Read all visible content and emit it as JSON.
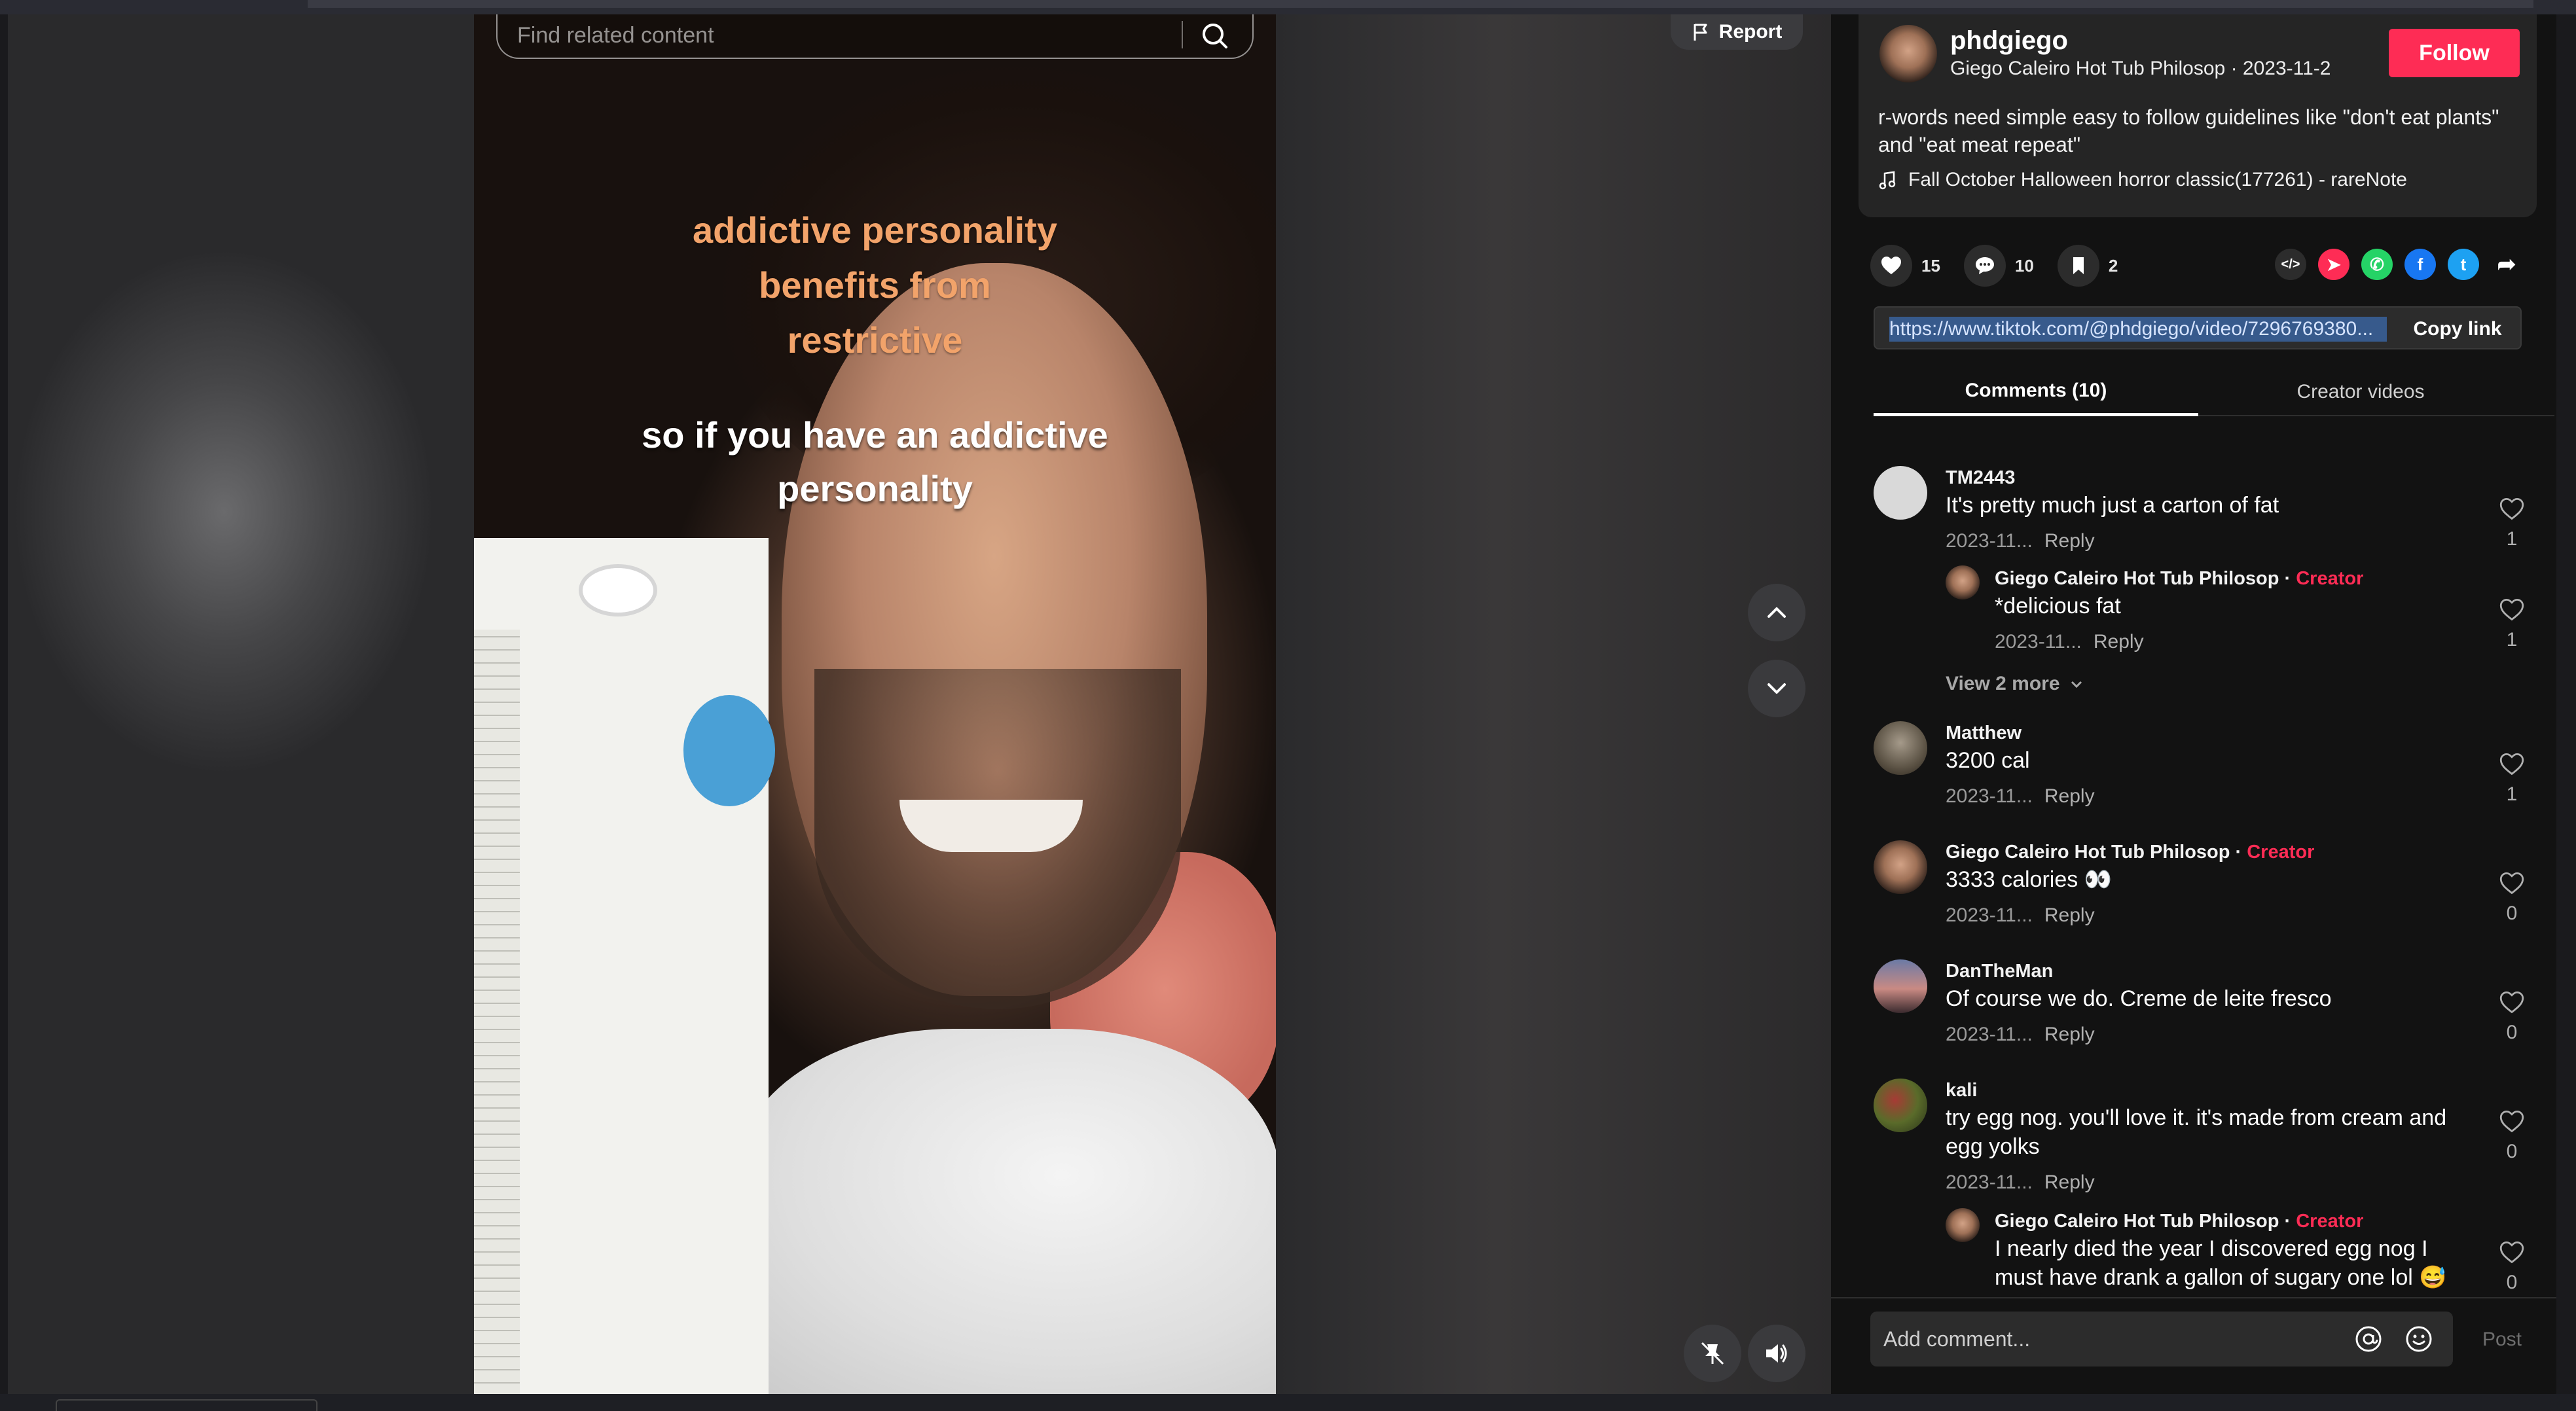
{
  "search": {
    "placeholder": "Find related content"
  },
  "report": {
    "label": "Report"
  },
  "video": {
    "overlay_lines": [
      "addictive personality",
      "benefits from",
      "restrictive"
    ],
    "caption_lines": [
      "so if you have an addictive",
      "personality"
    ]
  },
  "author": {
    "username": "phdgiego",
    "subtitle": "Giego Caleiro Hot Tub Philosop · 2023-11-2",
    "follow_label": "Follow"
  },
  "description": "r-words need simple easy to follow guidelines like \"don't eat plants\" and \"eat meat repeat\"",
  "music": "Fall October Halloween horror classic(177261) - rareNote",
  "stats": {
    "likes": "15",
    "comments": "10",
    "saves": "2"
  },
  "share": {
    "icons": [
      "embed-icon",
      "send-icon",
      "whatsapp-icon",
      "facebook-icon",
      "twitter-icon",
      "share-arrow-icon"
    ]
  },
  "link": {
    "url": "https://www.tiktok.com/@phdgiego/video/7296769380...",
    "copy_label": "Copy link"
  },
  "tabs": {
    "comments": "Comments (10)",
    "creator_videos": "Creator videos"
  },
  "comments": [
    {
      "name": "TM2443",
      "text": "It's pretty much just a carton of fat",
      "date": "2023-11...",
      "reply": "Reply",
      "likes": "1"
    },
    {
      "name": "Giego Caleiro Hot Tub Philosop · ",
      "creator": "Creator",
      "text": "*delicious fat",
      "date": "2023-11...",
      "reply": "Reply",
      "likes": "1"
    },
    {
      "name": "Matthew",
      "text": "3200 cal",
      "date": "2023-11...",
      "reply": "Reply",
      "likes": "1"
    },
    {
      "name": "Giego Caleiro Hot Tub Philosop · ",
      "creator": "Creator",
      "text": "3333 calories 👀",
      "date": "2023-11...",
      "reply": "Reply",
      "likes": "0"
    },
    {
      "name": "DanTheMan",
      "text": "Of course we do. Creme de leite fresco",
      "date": "2023-11...",
      "reply": "Reply",
      "likes": "0"
    },
    {
      "name": "kali",
      "text": "try egg nog. you'll love it. it's made from cream and egg yolks",
      "date": "2023-11...",
      "reply": "Reply",
      "likes": "0"
    },
    {
      "name": "Giego Caleiro Hot Tub Philosop · ",
      "creator": "Creator",
      "text": "I nearly died the year I discovered egg nog I must have drank a gallon of sugary one lol 😅",
      "likes": "0"
    }
  ],
  "view_more": "View 2 more",
  "add_comment": {
    "placeholder": "Add comment...",
    "post_label": "Post"
  },
  "colors": {
    "accent": "#fe2c55",
    "panel_bg": "#121212",
    "card_bg": "#252525"
  }
}
